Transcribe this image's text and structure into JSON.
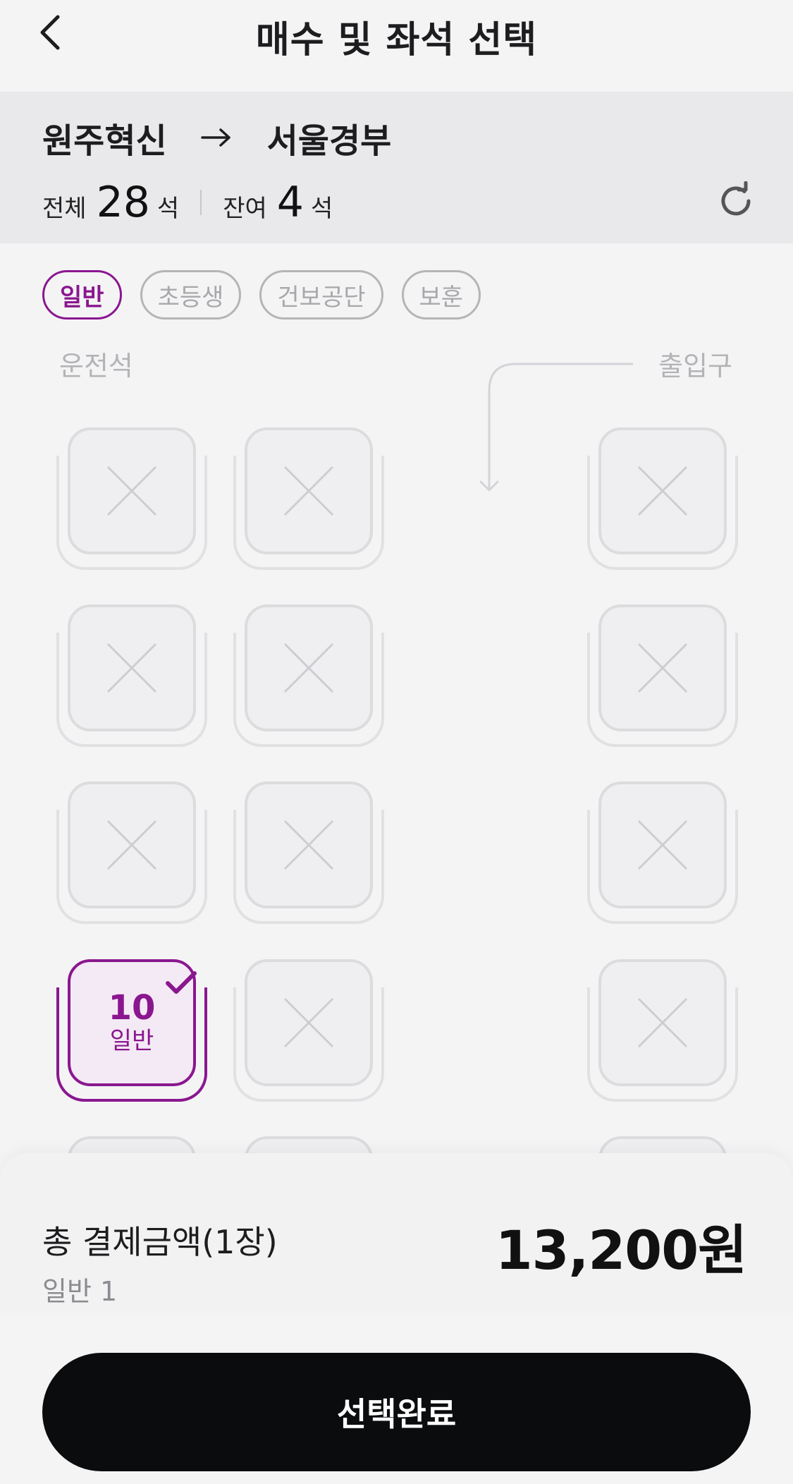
{
  "header": {
    "title": "매수 및 좌석 선택",
    "back_icon": "chevron-left-icon"
  },
  "route": {
    "from": "원주혁신",
    "to": "서울경부",
    "arrow_icon": "arrow-right-icon"
  },
  "counts": {
    "total_label": "전체",
    "total": "28",
    "total_unit": "석",
    "remaining_label": "잔여",
    "remaining": "4",
    "remaining_unit": "석",
    "refresh_icon": "refresh-icon"
  },
  "chips": [
    {
      "label": "일반",
      "active": true
    },
    {
      "label": "초등생",
      "active": false
    },
    {
      "label": "건보공단",
      "active": false
    },
    {
      "label": "보훈",
      "active": false
    }
  ],
  "labels": {
    "driver": "운전석",
    "entrance": "출입구"
  },
  "selected_seat": {
    "number": "10",
    "type": "일반"
  },
  "summary": {
    "label": "총 결제금액(1장)",
    "detail": "일반 1",
    "amount": "13,200원"
  },
  "footer": {
    "confirm_label": "선택완료"
  },
  "colors": {
    "accent": "#8a178f",
    "button_bg": "#0b0c0e",
    "page_bg": "#f4f4f5",
    "panel_bg": "#e9e9eb"
  }
}
